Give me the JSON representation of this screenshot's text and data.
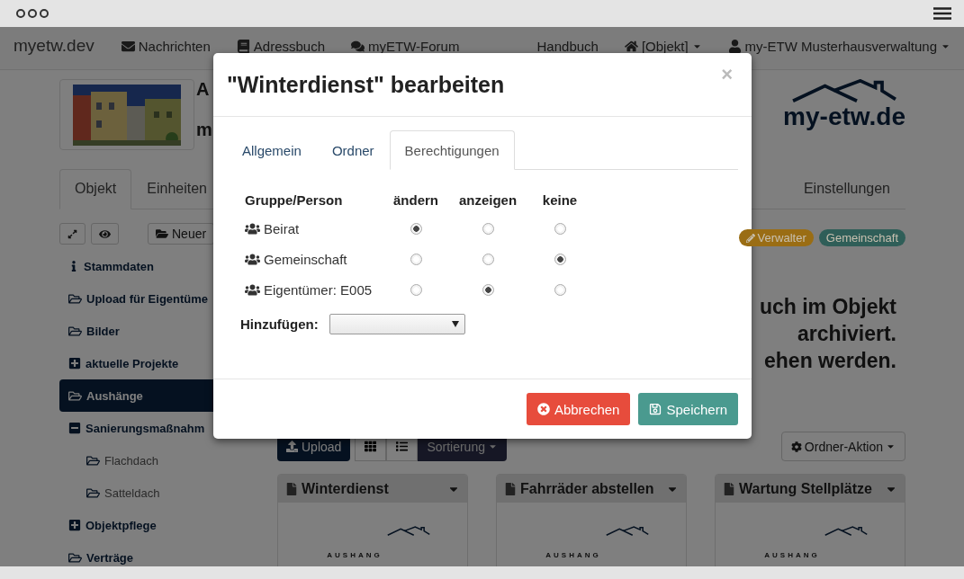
{
  "navbar": {
    "brand": "myetw.dev",
    "links": [
      {
        "label": "Nachrichten",
        "kind": "mail",
        "dropdown": false
      },
      {
        "label": "Adressbuch",
        "kind": "book",
        "dropdown": false
      },
      {
        "label": "myETW-Forum",
        "kind": "forum",
        "dropdown": false
      },
      {
        "label": "Handbuch",
        "kind": "plain",
        "dropdown": false
      },
      {
        "label": "[Objekt]",
        "kind": "home",
        "dropdown": true
      },
      {
        "label": "my-ETW Musterhausverwaltung",
        "kind": "user",
        "dropdown": true
      }
    ]
  },
  "header": {
    "title": "A",
    "subtitle": "m",
    "logo": "my-etw.de"
  },
  "tabs": [
    {
      "label": "Objekt",
      "selected": true
    },
    {
      "label": "Einheiten",
      "selected": false
    },
    {
      "label": "Einstellungen",
      "selected": false
    }
  ],
  "sidebar": {
    "new_button": "Neuer",
    "items": [
      {
        "label": "Stammdaten",
        "kind": "info",
        "selected": false
      },
      {
        "label": "Upload für Eigentüme",
        "kind": "folder",
        "selected": false
      },
      {
        "label": "Bilder",
        "kind": "folder",
        "selected": false
      },
      {
        "label": "aktuelle Projekte",
        "kind": "group",
        "expanded": false,
        "selected": false
      },
      {
        "label": "Aushänge",
        "kind": "folder",
        "selected": true
      },
      {
        "label": "Sanierungsmaßnahm",
        "kind": "group",
        "expanded": true,
        "selected": false,
        "children": [
          {
            "label": "Flachdach",
            "kind": "folder",
            "selected": false
          },
          {
            "label": "Satteldach",
            "kind": "folder",
            "selected": false
          }
        ]
      },
      {
        "label": "Objektpflege",
        "kind": "group",
        "expanded": false,
        "selected": false
      },
      {
        "label": "Verträge",
        "kind": "folder",
        "selected": false
      }
    ]
  },
  "badges": [
    {
      "label": "Verwalter",
      "color": "#9a6d14"
    },
    {
      "label": "Gemeinschaft",
      "color": "#2f5e58"
    }
  ],
  "notice_lines": [
    "uch im Objekt",
    "archiviert.",
    "ehen werden."
  ],
  "toolbar": {
    "upload": "Upload",
    "sort": "Sortierung",
    "folder_action": "Ordner-Aktion"
  },
  "cards": [
    {
      "title": "Winterdienst",
      "label": "AUSHANG"
    },
    {
      "title": "Fahrräder abstellen",
      "label": "AUSHANG"
    },
    {
      "title": "Wartung Stellplätze",
      "label": "AUSHANG"
    }
  ],
  "modal": {
    "title": "\"Winterdienst\" bearbeiten",
    "close": "×",
    "tabs": [
      {
        "label": "Allgemein",
        "selected": false
      },
      {
        "label": "Ordner",
        "selected": false
      },
      {
        "label": "Berechtigungen",
        "selected": true
      }
    ],
    "columns": [
      "Gruppe/Person",
      "ändern",
      "anzeigen",
      "keine"
    ],
    "rows": [
      {
        "name": "Beirat",
        "choices": [
          {
            "selected": true
          },
          {
            "selected": false
          },
          {
            "selected": false
          }
        ]
      },
      {
        "name": "Gemeinschaft",
        "choices": [
          {
            "selected": false
          },
          {
            "selected": false
          },
          {
            "selected": true
          }
        ]
      },
      {
        "name": "Eigentümer: E005",
        "choices": [
          {
            "selected": false
          },
          {
            "selected": true
          },
          {
            "selected": false
          }
        ]
      }
    ],
    "add_label": "Hinzufügen:",
    "buttons": [
      {
        "label": "Abbrechen",
        "kind": "cancel"
      },
      {
        "label": "Speichern",
        "kind": "save"
      }
    ]
  }
}
